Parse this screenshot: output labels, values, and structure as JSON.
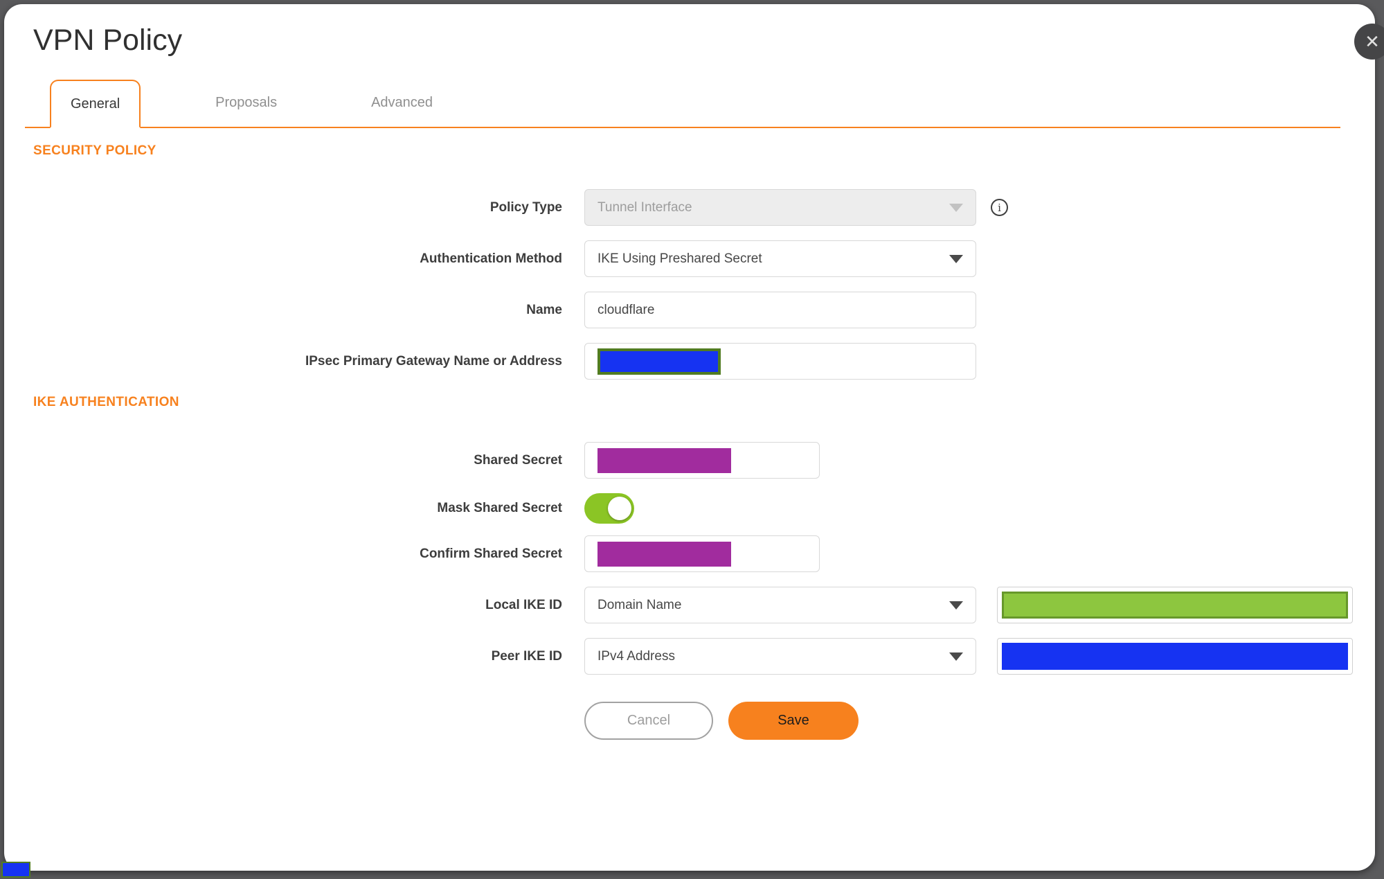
{
  "window": {
    "title": "VPN Policy",
    "close_icon": "✕"
  },
  "tabs": [
    {
      "label": "General",
      "active": true
    },
    {
      "label": "Proposals",
      "active": false
    },
    {
      "label": "Advanced",
      "active": false
    }
  ],
  "security_policy": {
    "heading": "SECURITY POLICY",
    "policy_type": {
      "label": "Policy Type",
      "value": "Tunnel Interface",
      "state": "disabled",
      "dropdown_icon": "caret-down",
      "info_icon": "i"
    },
    "authentication_method": {
      "label": "Authentication Method",
      "value": "IKE Using Preshared Secret",
      "dropdown_icon": "caret-down"
    },
    "name": {
      "label": "Name",
      "value": "cloudflare"
    },
    "gateway": {
      "label": "IPsec Primary Gateway Name or Address",
      "value": "",
      "redacted": true
    }
  },
  "ike_authentication": {
    "heading": "IKE AUTHENTICATION",
    "shared_secret": {
      "label": "Shared Secret",
      "value": "",
      "redacted": true
    },
    "mask_shared_secret": {
      "label": "Mask Shared Secret",
      "state": "on"
    },
    "confirm_shared_secret": {
      "label": "Confirm Shared Secret",
      "value": "",
      "redacted": true
    },
    "local_ike_id": {
      "label": "Local IKE ID",
      "value": "Domain Name",
      "dropdown_icon": "caret-down",
      "redacted_value": true
    },
    "peer_ike_id": {
      "label": "Peer IKE ID",
      "value": "IPv4 Address",
      "dropdown_icon": "caret-down",
      "redacted_value": true
    }
  },
  "actions": {
    "cancel": "Cancel",
    "save": "Save"
  },
  "colors": {
    "accent_orange": "#F7811E",
    "toggle_green": "#8BC525",
    "redaction_purple": "#A12C9E",
    "redaction_blue": "#1633F2",
    "redaction_green": "#8DC63F",
    "redaction_green_border": "#67982B",
    "redaction_olive_border": "#517C21",
    "backdrop_gray": "#5A5A5C"
  }
}
